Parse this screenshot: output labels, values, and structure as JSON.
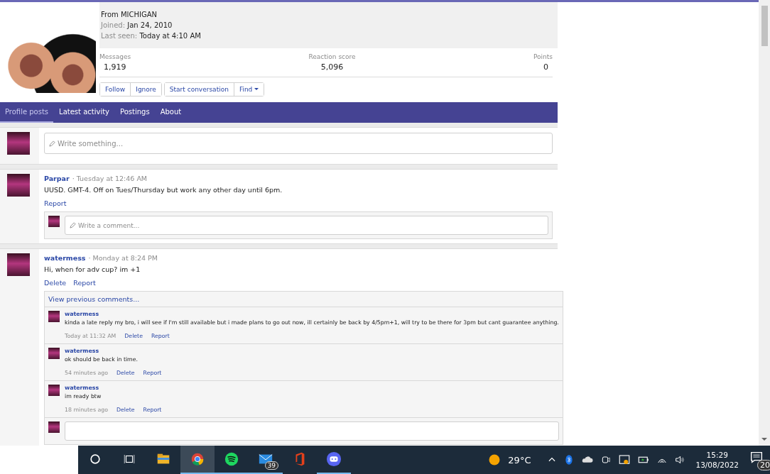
{
  "profile": {
    "location": "From MICHIGAN",
    "joined_label": "Joined:",
    "joined_value": "Jan 24, 2010",
    "last_seen_label": "Last seen:",
    "last_seen_value": "Today at 4:10 AM",
    "stats": [
      {
        "label": "Messages",
        "value": "1,919"
      },
      {
        "label": "Reaction score",
        "value": "5,096"
      },
      {
        "label": "Points",
        "value": "0"
      }
    ],
    "button_groups": [
      [
        "Follow",
        "Ignore"
      ],
      [
        "Start conversation",
        "Find"
      ]
    ]
  },
  "tabs": [
    {
      "label": "Profile posts",
      "selected": true
    },
    {
      "label": "Latest activity",
      "selected": false
    },
    {
      "label": "Postings",
      "selected": false
    },
    {
      "label": "About",
      "selected": false
    }
  ],
  "composer": {
    "placeholder": "Write something..."
  },
  "posts": [
    {
      "author": "Parpar",
      "time": "· Tuesday at 12:46 AM",
      "text": "UUSD. GMT-4. Off on Tues/Thursday but work any other day until 6pm.",
      "actions": [
        "Report"
      ],
      "comment_placeholder": "Write a comment..."
    },
    {
      "author": "watermess",
      "time": "· Monday at 8:24 PM",
      "text": "Hi, when for adv cup? im +1",
      "actions": [
        "Delete",
        "Report"
      ],
      "view_previous": "View previous comments...",
      "comments": [
        {
          "author": "watermess",
          "text": "kinda a late reply my bro, i will see if I'm still available but i made plans to go out now, ill certainly be back by 4/5pm+1, will try to be there for 3pm but cant guarantee anything.",
          "time": "Today at 11:32 AM",
          "actions": [
            "Delete",
            "Report"
          ]
        },
        {
          "author": "watermess",
          "text": "ok should be back in time.",
          "time": "54 minutes ago",
          "actions": [
            "Delete",
            "Report"
          ]
        },
        {
          "author": "watermess",
          "text": "im ready btw",
          "time": "18 minutes ago",
          "actions": [
            "Delete",
            "Report"
          ]
        }
      ]
    }
  ],
  "taskbar": {
    "apps": [
      {
        "kind": "explorer",
        "running": false,
        "selected": false
      },
      {
        "kind": "chrome",
        "running": true,
        "selected": true
      },
      {
        "kind": "spotify",
        "running": true,
        "selected": false
      },
      {
        "kind": "mail",
        "running": true,
        "selected": false,
        "badge": "39"
      },
      {
        "kind": "office",
        "running": false,
        "selected": false
      },
      {
        "kind": "discord",
        "running": true,
        "selected": false
      }
    ],
    "temperature": "29°C",
    "time": "15:29",
    "date": "13/08/2022",
    "notifications": "20"
  }
}
